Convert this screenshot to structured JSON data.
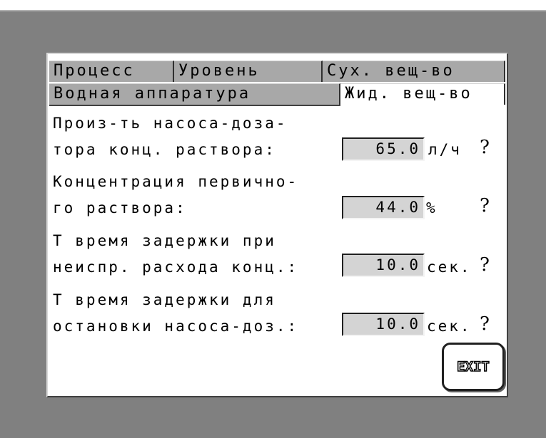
{
  "tabs_row1": [
    "Процесс",
    "Уровень",
    "Сух. вещ-во"
  ],
  "tabs_row2": [
    "Водная аппаратура",
    "Жид. вещ-во"
  ],
  "rows": [
    {
      "line1": "Произ-ть насоса-доза-",
      "line2": "тора конц. раствора:",
      "value": "65.0",
      "unit": "л/ч"
    },
    {
      "line1": "Концентрация первично-",
      "line2": "го раствора:",
      "value": "44.0",
      "unit": "%"
    },
    {
      "line1": "Т время задержки при",
      "line2": "неиспр. расхода конц.:",
      "value": "10.0",
      "unit": "сек."
    },
    {
      "line1": "Т время задержки для",
      "line2": "остановки насоса-доз.:",
      "value": "10.0",
      "unit": "сек."
    }
  ],
  "help_glyph": "?",
  "exit_label": "EXIT"
}
